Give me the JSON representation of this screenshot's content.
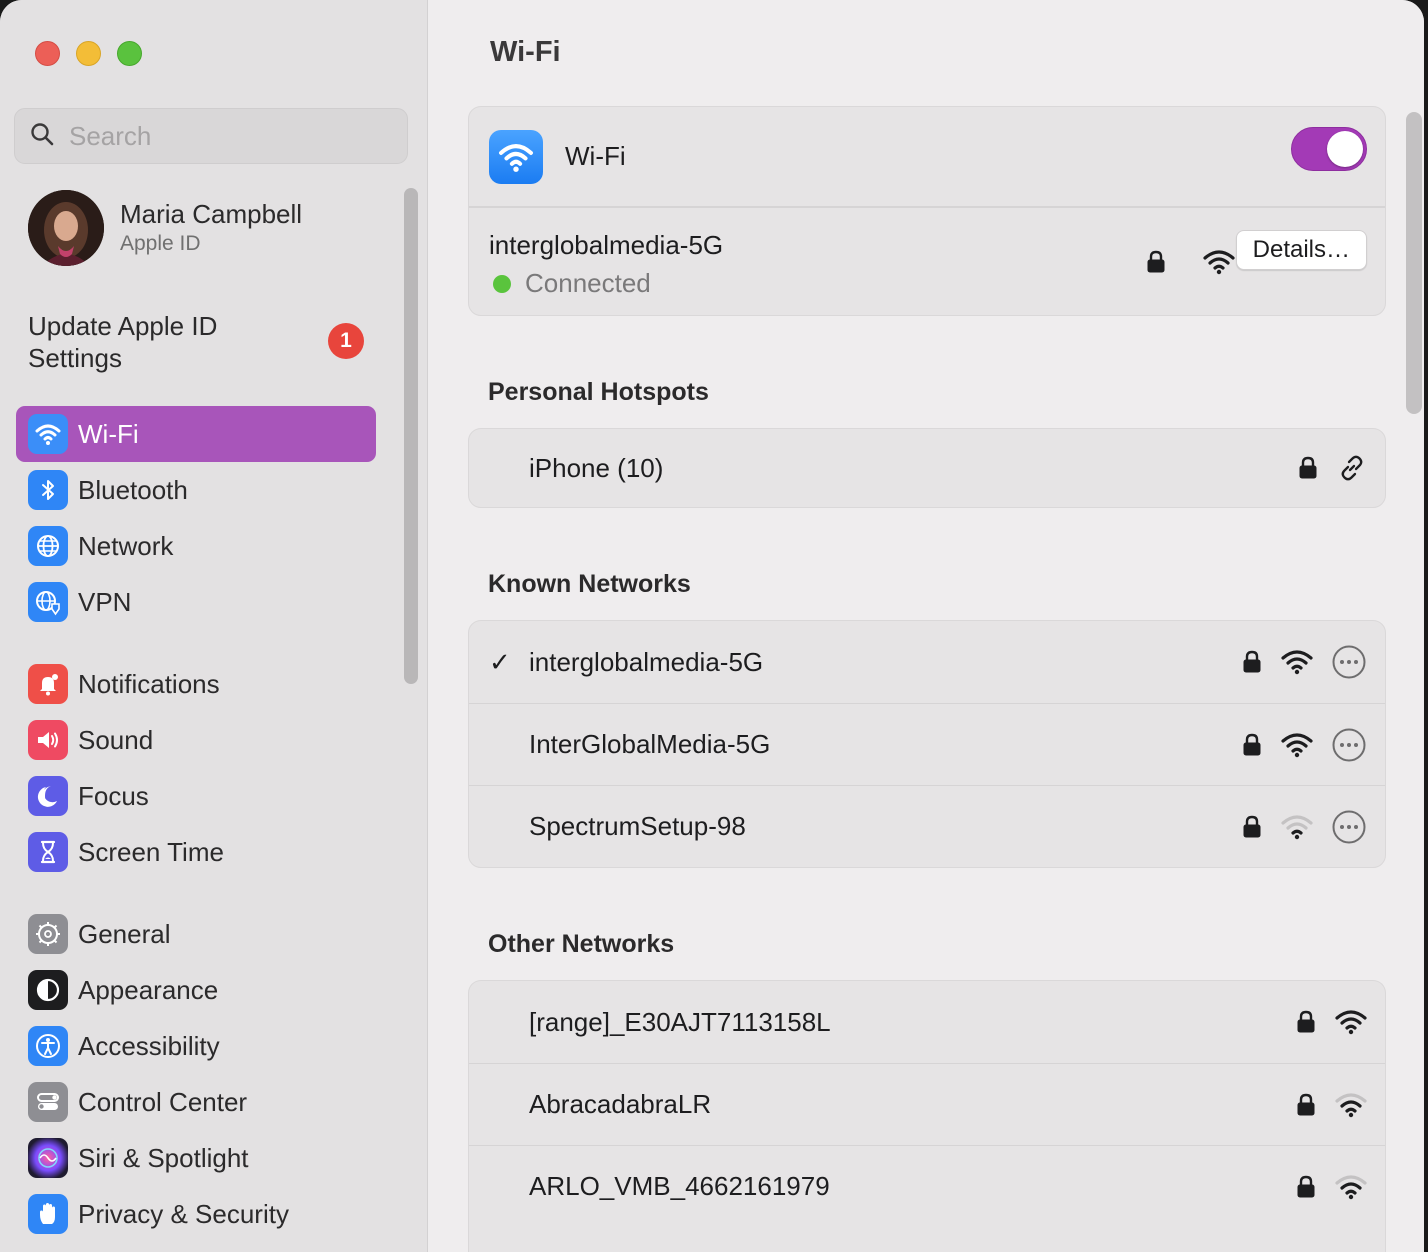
{
  "sidebar": {
    "search_placeholder": "Search",
    "profile": {
      "name": "Maria Campbell",
      "subtitle": "Apple ID"
    },
    "update": {
      "label": "Update Apple ID Settings",
      "badge": "1"
    },
    "groups": [
      [
        {
          "label": "Wi-Fi",
          "icon": "wifi-icon",
          "color": "#2f86f6",
          "active": true
        },
        {
          "label": "Bluetooth",
          "icon": "bluetooth-icon",
          "color": "#2f86f6"
        },
        {
          "label": "Network",
          "icon": "globe-icon",
          "color": "#2f86f6"
        },
        {
          "label": "VPN",
          "icon": "vpn-icon",
          "color": "#2f86f6"
        }
      ],
      [
        {
          "label": "Notifications",
          "icon": "bell-icon",
          "color": "#ef4f48"
        },
        {
          "label": "Sound",
          "icon": "speaker-icon",
          "color": "#ef4a62"
        },
        {
          "label": "Focus",
          "icon": "moon-icon",
          "color": "#5e5ce6"
        },
        {
          "label": "Screen Time",
          "icon": "hourglass-icon",
          "color": "#5e5ce6"
        }
      ],
      [
        {
          "label": "General",
          "icon": "gear-icon",
          "color": "#8e8e93"
        },
        {
          "label": "Appearance",
          "icon": "appearance-icon",
          "color": "#1d1d1f"
        },
        {
          "label": "Accessibility",
          "icon": "accessibility-icon",
          "color": "#2f86f6"
        },
        {
          "label": "Control Center",
          "icon": "toggles-icon",
          "color": "#8e8e93"
        },
        {
          "label": "Siri & Spotlight",
          "icon": "siri-icon",
          "color": "#2a2240"
        },
        {
          "label": "Privacy & Security",
          "icon": "hand-icon",
          "color": "#2f86f6"
        }
      ]
    ]
  },
  "main": {
    "title": "Wi-Fi",
    "wifi_toggle": {
      "label": "Wi-Fi",
      "on": true,
      "accent": "#a33ab6"
    },
    "current": {
      "name": "interglobalmedia-5G",
      "status": "Connected",
      "details_label": "Details…"
    },
    "hotspots": {
      "heading": "Personal Hotspots",
      "items": [
        {
          "name": "iPhone (10)"
        }
      ]
    },
    "known": {
      "heading": "Known Networks",
      "items": [
        {
          "name": "interglobalmedia-5G",
          "checked": true,
          "signal": "strong"
        },
        {
          "name": "InterGlobalMedia-5G",
          "checked": false,
          "signal": "strong"
        },
        {
          "name": "SpectrumSetup-98",
          "checked": false,
          "signal": "weak"
        }
      ]
    },
    "other": {
      "heading": "Other Networks",
      "items": [
        {
          "name": "[range]_E30AJT7113158L",
          "signal": "strong"
        },
        {
          "name": "AbracadabraLR",
          "signal": "medium"
        },
        {
          "name": "ARLO_VMB_4662161979",
          "signal": "medium"
        }
      ]
    }
  }
}
